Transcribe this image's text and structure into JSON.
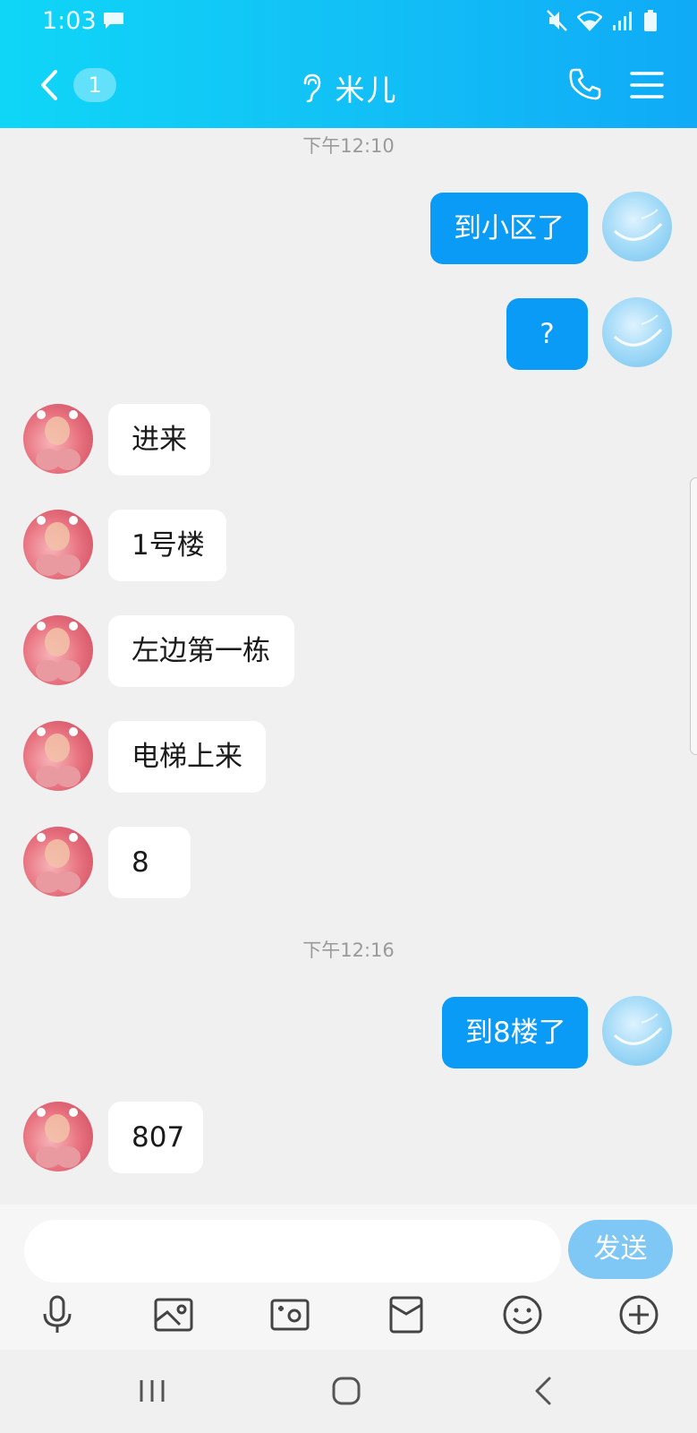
{
  "status_bar": {
    "time": "1:03"
  },
  "header": {
    "unread_count": "1",
    "title": "米儿"
  },
  "messages": [
    {
      "type": "time",
      "text": "下午12:10"
    },
    {
      "type": "self",
      "text": "到小区了"
    },
    {
      "type": "self",
      "text": "?"
    },
    {
      "type": "other",
      "text": "进来"
    },
    {
      "type": "other",
      "text": "1号楼"
    },
    {
      "type": "other",
      "text": "左边第一栋"
    },
    {
      "type": "other",
      "text": "电梯上来"
    },
    {
      "type": "other",
      "text": "8"
    },
    {
      "type": "time",
      "text": "下午12:16"
    },
    {
      "type": "self",
      "text": "到8楼了"
    },
    {
      "type": "other",
      "text": "807"
    }
  ],
  "input": {
    "value": "",
    "send_label": "发送"
  },
  "toolbar_icons": [
    "microphone-icon",
    "image-icon",
    "camera-icon",
    "red-packet-icon",
    "emoji-icon",
    "plus-icon"
  ],
  "colors": {
    "header_start": "#0fd6f7",
    "header_end": "#10aaf7",
    "self_bubble": "#0a9bf7",
    "send_button": "#7fc7f5"
  }
}
